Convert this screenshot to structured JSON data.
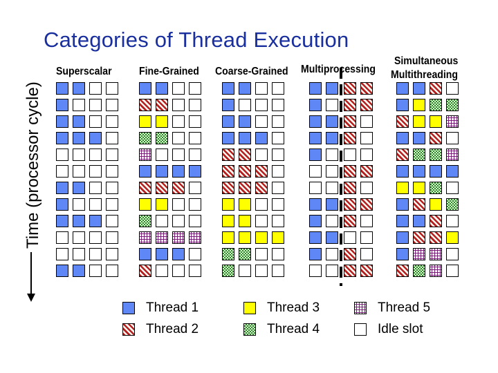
{
  "title": "Categories of Thread Execution",
  "y_axis_label": "Time (processor cycle)",
  "categories": [
    {
      "label": "Superscalar",
      "rows": [
        [
          1,
          1,
          0,
          0
        ],
        [
          1,
          0,
          0,
          0
        ],
        [
          1,
          1,
          0,
          0
        ],
        [
          1,
          1,
          1,
          0
        ],
        [
          0,
          0,
          0,
          0
        ],
        [
          0,
          0,
          0,
          0
        ],
        [
          1,
          1,
          0,
          0
        ],
        [
          1,
          0,
          0,
          0
        ],
        [
          1,
          1,
          1,
          0
        ],
        [
          0,
          0,
          0,
          0
        ],
        [
          0,
          0,
          0,
          0
        ],
        [
          1,
          1,
          0,
          0
        ]
      ]
    },
    {
      "label": "Fine-Grained",
      "rows": [
        [
          1,
          1,
          0,
          0
        ],
        [
          2,
          2,
          0,
          0
        ],
        [
          3,
          3,
          0,
          0
        ],
        [
          4,
          4,
          0,
          0
        ],
        [
          5,
          0,
          0,
          0
        ],
        [
          1,
          1,
          1,
          1
        ],
        [
          2,
          2,
          2,
          0
        ],
        [
          3,
          3,
          0,
          0
        ],
        [
          4,
          0,
          0,
          0
        ],
        [
          5,
          5,
          5,
          5
        ],
        [
          1,
          1,
          1,
          0
        ],
        [
          2,
          0,
          0,
          0
        ]
      ]
    },
    {
      "label": "Coarse-Grained",
      "rows": [
        [
          1,
          1,
          0,
          0
        ],
        [
          1,
          0,
          0,
          0
        ],
        [
          1,
          1,
          0,
          0
        ],
        [
          1,
          1,
          1,
          0
        ],
        [
          2,
          2,
          0,
          0
        ],
        [
          2,
          2,
          2,
          0
        ],
        [
          2,
          2,
          2,
          0
        ],
        [
          3,
          3,
          0,
          0
        ],
        [
          3,
          3,
          0,
          0
        ],
        [
          3,
          3,
          3,
          3
        ],
        [
          4,
          4,
          0,
          0
        ],
        [
          4,
          0,
          0,
          0
        ]
      ]
    },
    {
      "label": "Multiprocessing",
      "rows": [
        [
          1,
          1,
          2,
          2
        ],
        [
          1,
          0,
          2,
          2
        ],
        [
          1,
          1,
          2,
          0
        ],
        [
          1,
          1,
          2,
          0
        ],
        [
          1,
          0,
          0,
          0
        ],
        [
          0,
          0,
          2,
          2
        ],
        [
          0,
          0,
          2,
          0
        ],
        [
          1,
          1,
          2,
          2
        ],
        [
          1,
          0,
          2,
          0
        ],
        [
          1,
          1,
          0,
          0
        ],
        [
          1,
          0,
          2,
          0
        ],
        [
          0,
          0,
          2,
          2
        ]
      ]
    },
    {
      "label_line1": "Simultaneous",
      "label": "Multithreading",
      "rows": [
        [
          1,
          1,
          2,
          0
        ],
        [
          1,
          3,
          4,
          4
        ],
        [
          2,
          3,
          3,
          5
        ],
        [
          1,
          1,
          2,
          0
        ],
        [
          2,
          4,
          4,
          5
        ],
        [
          1,
          1,
          1,
          1
        ],
        [
          3,
          3,
          4,
          0
        ],
        [
          1,
          2,
          3,
          4
        ],
        [
          1,
          1,
          2,
          0
        ],
        [
          1,
          2,
          2,
          3
        ],
        [
          1,
          5,
          5,
          0
        ],
        [
          2,
          4,
          5,
          0
        ]
      ]
    }
  ],
  "legend": [
    {
      "key": 1,
      "label": "Thread 1",
      "color": "#5f87f5"
    },
    {
      "key": 2,
      "label": "Thread 2",
      "color": "#b31e1e"
    },
    {
      "key": 3,
      "label": "Thread 3",
      "color": "#ffff00"
    },
    {
      "key": 4,
      "label": "Thread 4",
      "color": "#2d8a2d"
    },
    {
      "key": 5,
      "label": "Thread 5",
      "color": "#7a1a7a"
    },
    {
      "key": 0,
      "label": "Idle slot",
      "color": "#ffffff"
    }
  ]
}
